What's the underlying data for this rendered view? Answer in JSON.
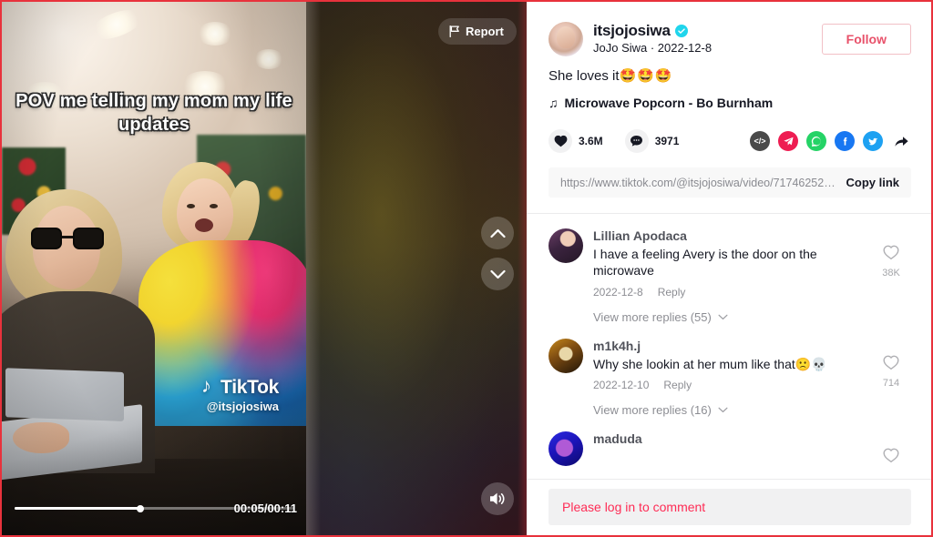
{
  "video": {
    "caption": "POV me telling my mom my life updates",
    "watermark_brand": "TikTok",
    "watermark_handle": "@itsjojosiwa",
    "time_label": "00:05/00:11",
    "progress_percent": 45,
    "report_label": "Report"
  },
  "author": {
    "username": "itsjojosiwa",
    "display_name_and_date": "JoJo Siwa · 2022-12-8",
    "follow_label": "Follow",
    "verified": true
  },
  "post": {
    "description_text": "She loves it",
    "description_emoji": "🤩🤩🤩",
    "music": "Microwave Popcorn - Bo Burnham"
  },
  "engagement": {
    "likes": "3.6M",
    "comments": "3971",
    "embed_label": "</>"
  },
  "link": {
    "url": "https://www.tiktok.com/@itsjojosiwa/video/7174625223508...",
    "copy_label": "Copy link"
  },
  "comments": [
    {
      "name": "Lillian Apodaca",
      "text": "I have a feeling Avery is the door on the microwave",
      "date": "2022-12-8",
      "reply_label": "Reply",
      "likes": "38K",
      "view_replies": "View more replies (55)"
    },
    {
      "name": "m1k4h.j",
      "text": "Why she lookin at her mum like that🙁💀",
      "date": "2022-12-10",
      "reply_label": "Reply",
      "likes": "714",
      "view_replies": "View more replies (16)"
    },
    {
      "name": "maduda",
      "text": "",
      "date": "",
      "reply_label": "",
      "likes": "",
      "view_replies": ""
    }
  ],
  "login": {
    "prompt": "Please log in to comment"
  },
  "colors": {
    "accent_red": "#fe2c55",
    "follow_text": "#e8516a",
    "verified_blue": "#20d5ec",
    "facebook": "#1877f2",
    "twitter": "#1da1f2",
    "whatsapp": "#25d366",
    "telegram": "#ee1d52"
  }
}
